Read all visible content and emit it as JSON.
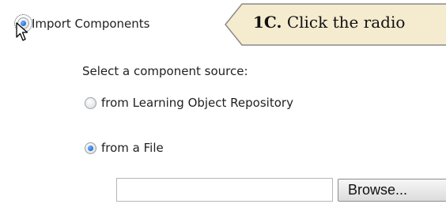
{
  "import": {
    "label": "Import Components",
    "selected": true
  },
  "callout": {
    "step": "1C.",
    "text": "Click the radio"
  },
  "source": {
    "prompt": "Select a component source:",
    "options": [
      {
        "label": "from Learning Object Repository",
        "selected": false
      },
      {
        "label": "from a File",
        "selected": true
      }
    ]
  },
  "file_picker": {
    "value": "",
    "browse_label": "Browse..."
  },
  "colors": {
    "callout_fill": "#f5ecd0",
    "radio_dot": "#1a66cc"
  },
  "icons": {
    "cursor": "arrow-pointer-icon"
  }
}
